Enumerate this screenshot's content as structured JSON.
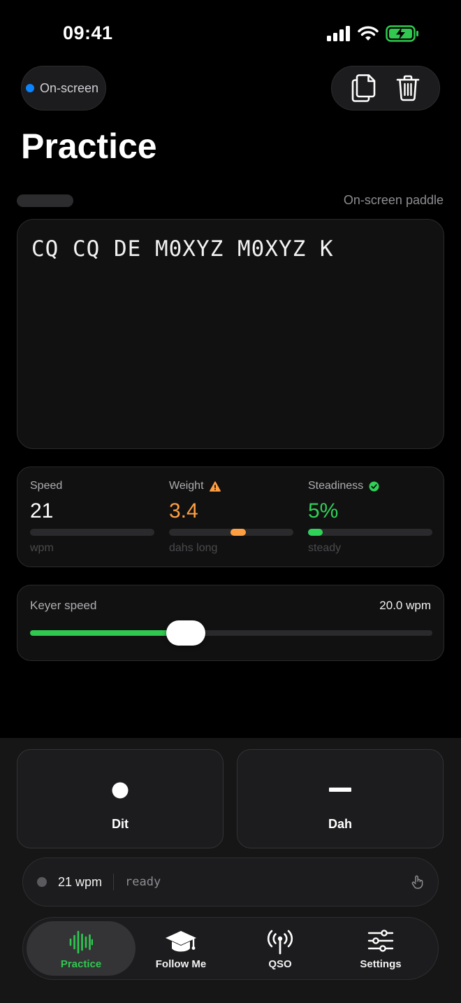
{
  "status_bar": {
    "time": "09:41"
  },
  "header": {
    "input_source": "On-screen",
    "title": "Practice",
    "input_mode_label": "On-screen paddle",
    "copy_icon": "copy-icon",
    "trash_icon": "trash-icon"
  },
  "decoder": {
    "text": "CQ CQ DE M0XYZ M0XYZ K"
  },
  "stats": {
    "speed": {
      "label": "Speed",
      "value": "21",
      "unit": "wpm",
      "level": 0.0,
      "color": "#ffffff"
    },
    "weight": {
      "label": "Weight",
      "value": "3.4",
      "unit": "dahs long",
      "level": 0.55,
      "color": "#ff9f43",
      "indicator": "warning-icon"
    },
    "steadiness": {
      "label": "Steadiness",
      "value": "5%",
      "unit": "steady",
      "level": 0.05,
      "color": "#30d158",
      "indicator": "check-icon"
    }
  },
  "keyer": {
    "label": "Keyer speed",
    "value": "20.0 wpm",
    "level": 0.39
  },
  "paddles": {
    "dit_label": "Dit",
    "dah_label": "Dah"
  },
  "status_strip": {
    "wpm": "21 wpm",
    "state": "ready",
    "icon": "tap-icon"
  },
  "tabs": [
    {
      "label": "Practice",
      "icon": "waveform-icon",
      "active": true
    },
    {
      "label": "Follow Me",
      "icon": "graduation-cap-icon",
      "active": false
    },
    {
      "label": "QSO",
      "icon": "antenna-icon",
      "active": false
    },
    {
      "label": "Settings",
      "icon": "sliders-icon",
      "active": false
    }
  ],
  "colors": {
    "accent": "#30c84f",
    "warning": "#ff9f43",
    "info": "#0a84ff"
  }
}
